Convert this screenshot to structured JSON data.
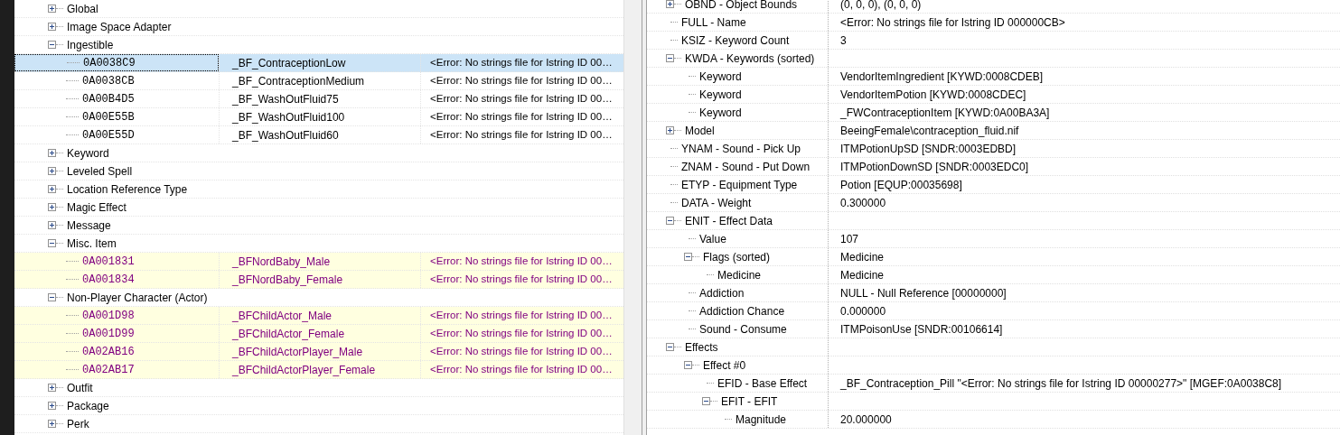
{
  "record_list": {
    "groups": [
      {
        "label": "Global",
        "expanded": false
      },
      {
        "label": "Image Space Adapter",
        "expanded": false
      },
      {
        "label": "Ingestible",
        "expanded": true,
        "children": [
          {
            "form_id": "0A0038C9",
            "editor_id": "_BF_ContraceptionLow",
            "name": "<Error: No strings file for Istring ID 00…",
            "selected": true,
            "highlighted": false
          },
          {
            "form_id": "0A0038CB",
            "editor_id": "_BF_ContraceptionMedium",
            "name": "<Error: No strings file for Istring ID 00…",
            "selected": false,
            "highlighted": false
          },
          {
            "form_id": "0A00B4D5",
            "editor_id": "_BF_WashOutFluid75",
            "name": "<Error: No strings file for Istring ID 00…",
            "selected": false,
            "highlighted": false
          },
          {
            "form_id": "0A00E55B",
            "editor_id": "_BF_WashOutFluid100",
            "name": "<Error: No strings file for Istring ID 00…",
            "selected": false,
            "highlighted": false
          },
          {
            "form_id": "0A00E55D",
            "editor_id": "_BF_WashOutFluid60",
            "name": "<Error: No strings file for Istring ID 00…",
            "selected": false,
            "highlighted": false
          }
        ]
      },
      {
        "label": "Keyword",
        "expanded": false
      },
      {
        "label": "Leveled Spell",
        "expanded": false
      },
      {
        "label": "Location Reference Type",
        "expanded": false
      },
      {
        "label": "Magic Effect",
        "expanded": false
      },
      {
        "label": "Message",
        "expanded": false
      },
      {
        "label": "Misc. Item",
        "expanded": true,
        "children": [
          {
            "form_id": "0A001831",
            "editor_id": "_BFNordBaby_Male",
            "name": "<Error: No strings file for Istring ID 00…",
            "selected": false,
            "highlighted": true
          },
          {
            "form_id": "0A001834",
            "editor_id": "_BFNordBaby_Female",
            "name": "<Error: No strings file for Istring ID 00…",
            "selected": false,
            "highlighted": true
          }
        ]
      },
      {
        "label": "Non-Player Character (Actor)",
        "expanded": true,
        "children": [
          {
            "form_id": "0A001D98",
            "editor_id": "_BFChildActor_Male",
            "name": "<Error: No strings file for Istring ID 00…",
            "selected": false,
            "highlighted": true
          },
          {
            "form_id": "0A001D99",
            "editor_id": "_BFChildActor_Female",
            "name": "<Error: No strings file for Istring ID 00…",
            "selected": false,
            "highlighted": true
          },
          {
            "form_id": "0A02AB16",
            "editor_id": "_BFChildActorPlayer_Male",
            "name": "<Error: No strings file for Istring ID 00…",
            "selected": false,
            "highlighted": true
          },
          {
            "form_id": "0A02AB17",
            "editor_id": "_BFChildActorPlayer_Female",
            "name": "<Error: No strings file for Istring ID 00…",
            "selected": false,
            "highlighted": true
          }
        ]
      },
      {
        "label": "Outfit",
        "expanded": false
      },
      {
        "label": "Package",
        "expanded": false
      },
      {
        "label": "Perk",
        "expanded": false
      }
    ]
  },
  "record_view": {
    "fields": [
      {
        "label": "OBND - Object Bounds",
        "value": "(0, 0, 0), (0, 0, 0)",
        "expanded": false
      },
      {
        "label": "FULL - Name",
        "value": "<Error: No strings file for Istring ID 000000CB>"
      },
      {
        "label": "KSIZ - Keyword Count",
        "value": "3"
      },
      {
        "label": "KWDA - Keywords (sorted)",
        "expanded": true,
        "children": [
          {
            "label": "Keyword",
            "value": "VendorItemIngredient [KYWD:0008CDEB]"
          },
          {
            "label": "Keyword",
            "value": "VendorItemPotion [KYWD:0008CDEC]"
          },
          {
            "label": "Keyword",
            "value": "_FWContraceptionItem [KYWD:0A00BA3A]"
          }
        ]
      },
      {
        "label": "Model",
        "value": "BeeingFemale\\contraception_fluid.nif",
        "expanded": false
      },
      {
        "label": "YNAM - Sound - Pick Up",
        "value": "ITMPotionUpSD [SNDR:0003EDBD]"
      },
      {
        "label": "ZNAM - Sound - Put Down",
        "value": "ITMPotionDownSD [SNDR:0003EDC0]"
      },
      {
        "label": "ETYP - Equipment Type",
        "value": "Potion [EQUP:00035698]"
      },
      {
        "label": "DATA - Weight",
        "value": "0.300000"
      },
      {
        "label": "ENIT - Effect Data",
        "expanded": true,
        "children": [
          {
            "label": "Value",
            "value": "107"
          },
          {
            "label": "Flags (sorted)",
            "value": "Medicine",
            "expanded": true,
            "children": [
              {
                "label": "Medicine",
                "value": "Medicine"
              }
            ]
          },
          {
            "label": "Addiction",
            "value": "NULL - Null Reference [00000000]"
          },
          {
            "label": "Addiction Chance",
            "value": "0.000000"
          },
          {
            "label": "Sound - Consume",
            "value": "ITMPoisonUse [SNDR:00106614]"
          }
        ]
      },
      {
        "label": "Effects",
        "expanded": true,
        "children": [
          {
            "label": "Effect #0",
            "expanded": true,
            "children": [
              {
                "label": "EFID - Base Effect",
                "value": "_BF_Contraception_Pill \"<Error: No strings file for Istring ID 00000277>\" [MGEF:0A0038C8]"
              },
              {
                "label": "EFIT - EFIT",
                "expanded": true,
                "children": [
                  {
                    "label": "Magnitude",
                    "value": "20.000000"
                  }
                ]
              }
            ]
          }
        ]
      }
    ]
  }
}
